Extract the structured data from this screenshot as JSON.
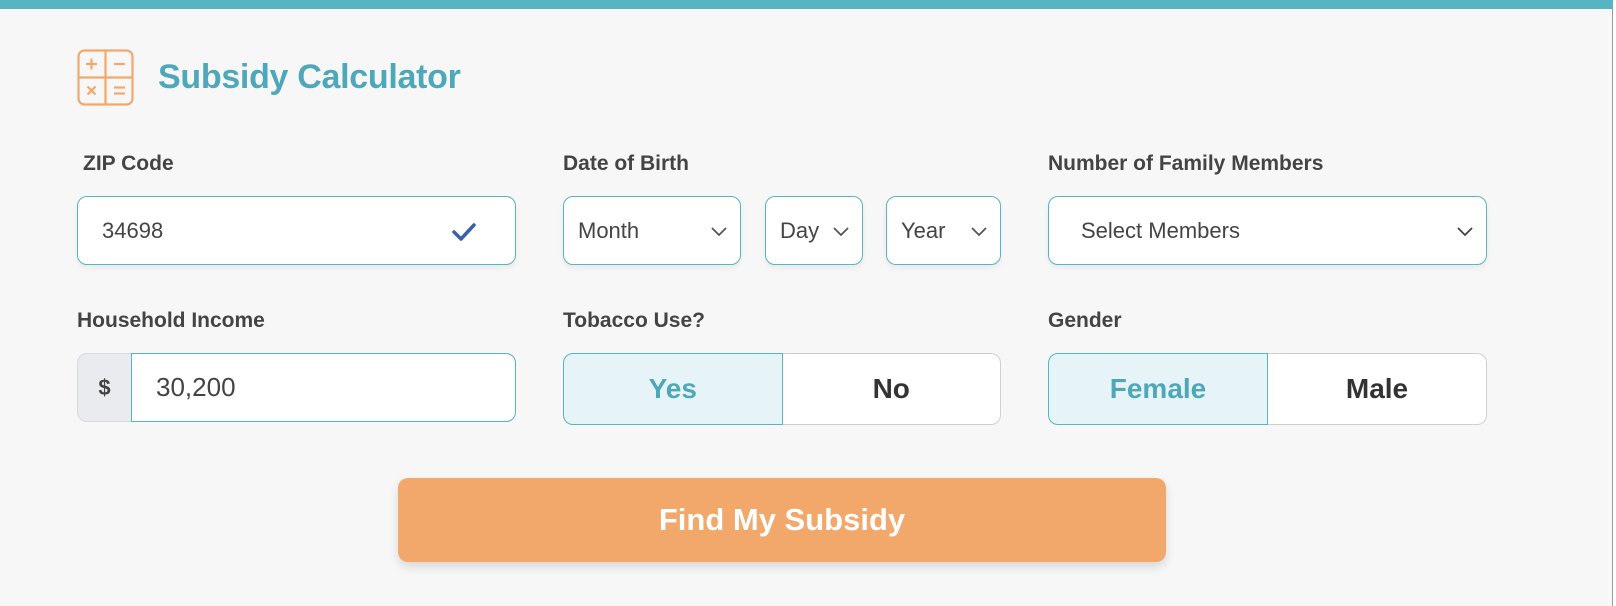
{
  "header": {
    "title": "Subsidy Calculator",
    "icon": "calculator-icon"
  },
  "colors": {
    "accent": "#57b4c2",
    "title": "#4fa8b9",
    "cta": "#f1a86a",
    "selected_bg": "#e7f4f7",
    "check": "#3d5ea8"
  },
  "zip": {
    "label": "ZIP Code",
    "value": "34698",
    "valid_icon": "checkmark-icon"
  },
  "dob": {
    "label": "Date of Birth",
    "month": {
      "value": "Month"
    },
    "day": {
      "value": "Day"
    },
    "year": {
      "value": "Year"
    }
  },
  "family": {
    "label": "Number of Family Members",
    "value": "Select Members"
  },
  "income": {
    "label": "Household Income",
    "prefix": "$",
    "value": "30,200"
  },
  "tobacco": {
    "label": "Tobacco Use?",
    "options": [
      {
        "label": "Yes",
        "selected": true
      },
      {
        "label": "No",
        "selected": false
      }
    ]
  },
  "gender": {
    "label": "Gender",
    "options": [
      {
        "label": "Female",
        "selected": true
      },
      {
        "label": "Male",
        "selected": false
      }
    ]
  },
  "submit": {
    "label": "Find My Subsidy"
  }
}
